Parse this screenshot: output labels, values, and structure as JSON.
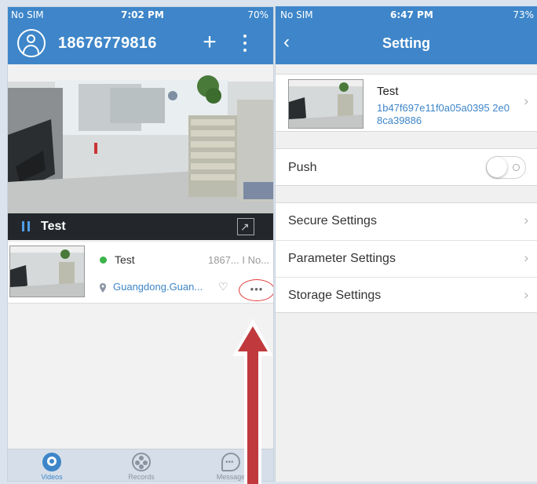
{
  "left_screen": {
    "status": {
      "carrier": "No SIM",
      "time": "7:02 PM",
      "battery": "70%"
    },
    "header": {
      "account": "18676779816"
    },
    "video": {
      "title": "Test"
    },
    "device": {
      "name": "Test",
      "id_truncated": "1867... I No...",
      "location": "Guangdong.Guan...",
      "more_label": "•••",
      "online_color": "#3cb44b"
    },
    "tabs": [
      {
        "label": "Videos",
        "icon": "camera-icon",
        "active": true
      },
      {
        "label": "Records",
        "icon": "film-reel-icon",
        "active": false
      },
      {
        "label": "Message",
        "icon": "chat-bubble-icon",
        "active": false
      }
    ]
  },
  "right_screen": {
    "status": {
      "carrier": "No SIM",
      "time": "6:47 PM",
      "battery": "73%"
    },
    "header": {
      "title": "Setting"
    },
    "device_card": {
      "name": "Test",
      "uid": "1b47f697e11f0a05a0395 2e08ca39886"
    },
    "push": {
      "label": "Push",
      "enabled": false
    },
    "settings": [
      {
        "label": "Secure Settings"
      },
      {
        "label": "Parameter Settings"
      },
      {
        "label": "Storage Settings"
      }
    ]
  },
  "colors": {
    "accent": "#3e86c9",
    "annotation": "#c0393c"
  }
}
